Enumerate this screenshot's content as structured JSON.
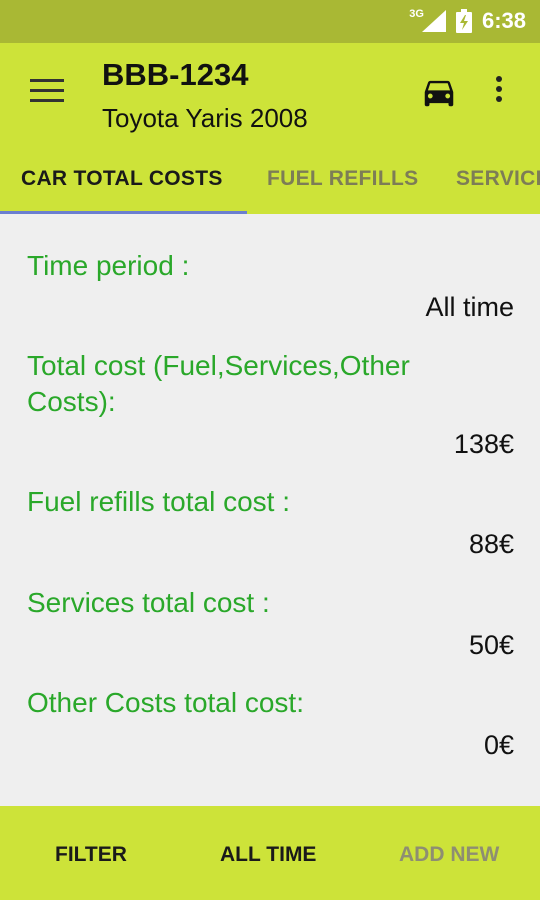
{
  "status_bar": {
    "network": "3G",
    "time": "6:38"
  },
  "app_bar": {
    "title": "BBB-1234",
    "subtitle": "Toyota Yaris 2008"
  },
  "tabs": [
    {
      "label": "CAR TOTAL COSTS",
      "active": true
    },
    {
      "label": "FUEL REFILLS",
      "active": false
    },
    {
      "label": "SERVICES",
      "active": false
    }
  ],
  "summary": {
    "time_period_label": "Time period :",
    "time_period_value": "All time",
    "total_cost_label": "Total cost (Fuel,Services,Other Costs):",
    "total_cost_value": "138€",
    "fuel_label": "Fuel refills total cost :",
    "fuel_value": "88€",
    "services_label": "Services total cost :",
    "services_value": "50€",
    "other_label": "Other Costs total cost:",
    "other_value": "0€"
  },
  "bottom_bar": {
    "filter": "FILTER",
    "all_time": "ALL TIME",
    "add_new": "ADD NEW"
  },
  "colors": {
    "status_bar": "#a9b834",
    "app_bar": "#cde339",
    "label_green": "#2aa82a",
    "tab_indicator": "#6b7fd0"
  }
}
